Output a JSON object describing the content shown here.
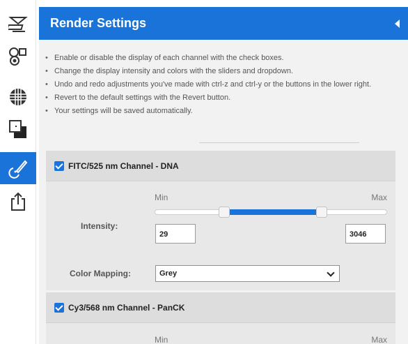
{
  "toolbar": {
    "items": [
      {
        "icon": "slide-scanner-icon"
      },
      {
        "icon": "channels-icon"
      },
      {
        "icon": "grid-globe-icon"
      },
      {
        "icon": "layers-icon"
      },
      {
        "icon": "paint-brush-icon",
        "active": true
      },
      {
        "icon": "share-export-icon"
      }
    ]
  },
  "panel": {
    "title": "Render Settings",
    "collapse_icon": "collapse-left-icon",
    "instructions": [
      "Enable or disable the display of each channel with the check boxes.",
      "Change the display intensity and colors with the sliders and dropdown.",
      "Undo and redo adjustments you've made with ctrl-z and ctrl-y or the buttons in the lower right.",
      "Revert to the default settings with the Revert button.",
      "Your settings will be saved automatically."
    ]
  },
  "channels": [
    {
      "name": "FITC/525 nm Channel - DNA",
      "checked": true,
      "min_label": "Min",
      "max_label": "Max",
      "intensity_label": "Intensity:",
      "min_value": "29",
      "max_value": "3046",
      "slider_low_fraction": 0.3,
      "slider_high_fraction": 0.72,
      "color_mapping_label": "Color Mapping:",
      "color_mapping_value": "Grey"
    },
    {
      "name": "Cy3/568 nm Channel - PanCK",
      "checked": true,
      "min_label": "Min",
      "max_label": "Max"
    }
  ],
  "colors": {
    "accent": "#1a73d9",
    "panel_bg": "#f2f2f2",
    "card_bg": "#e8e8e8"
  }
}
